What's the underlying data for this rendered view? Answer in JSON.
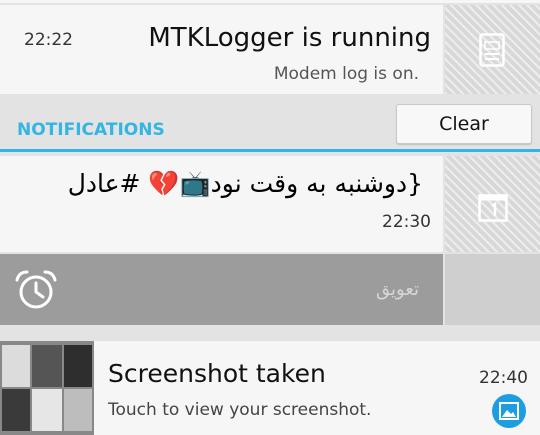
{
  "ongoing_notification": {
    "time": "22:22",
    "title": "MTKLogger is running",
    "subtitle": "Modem log is on.",
    "icon": "log-file-icon"
  },
  "section_header": {
    "label": "NOTIFICATIONS",
    "clear_label": "Clear",
    "accent_color": "#33b5e5"
  },
  "event_notification": {
    "title": "{دوشنبه به وقت نود📺💔 #عادل",
    "time": "22:30",
    "icon": "calendar-day-icon"
  },
  "snooze_action": {
    "label": "تعویق",
    "icon": "alarm-clock-icon"
  },
  "screenshot_notification": {
    "title": "Screenshot taken",
    "subtitle": "Touch to view your screenshot.",
    "time": "22:40",
    "icon": "gallery-image-icon"
  }
}
